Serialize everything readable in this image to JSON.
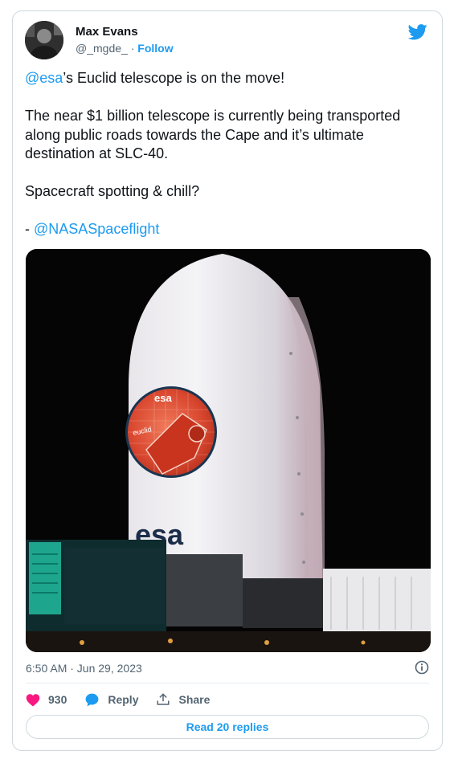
{
  "user": {
    "name": "Max Evans",
    "handle": "@_mgde_",
    "separator": " · ",
    "follow_label": "Follow"
  },
  "tweet": {
    "para1_mention": "@esa",
    "para1_rest": "’s Euclid telescope is on the move!",
    "para2": "The near $1 billion telescope is currently being transported along public roads towards the Cape and it’s ultimate destination at SLC-40.",
    "para3": "Spacecraft spotting & chill?",
    "para4_prefix": "- ",
    "para4_mention": "@NASASpaceflight"
  },
  "photo": {
    "fairing_logo_text": "esa",
    "patch_top_text": "esa",
    "patch_mission_text": "euclid"
  },
  "meta": {
    "timestamp": "6:50 AM · Jun 29, 2023"
  },
  "actions": {
    "like_count": "930",
    "reply_label": "Reply",
    "share_label": "Share"
  },
  "footer": {
    "read_replies_label": "Read 20 replies"
  },
  "colors": {
    "accent": "#1d9bf0",
    "like": "#f91880",
    "text": "#0f1419",
    "muted": "#536471"
  },
  "icons": [
    "twitter-bird-icon",
    "heart-icon",
    "reply-bubble-icon",
    "share-icon",
    "info-icon"
  ]
}
